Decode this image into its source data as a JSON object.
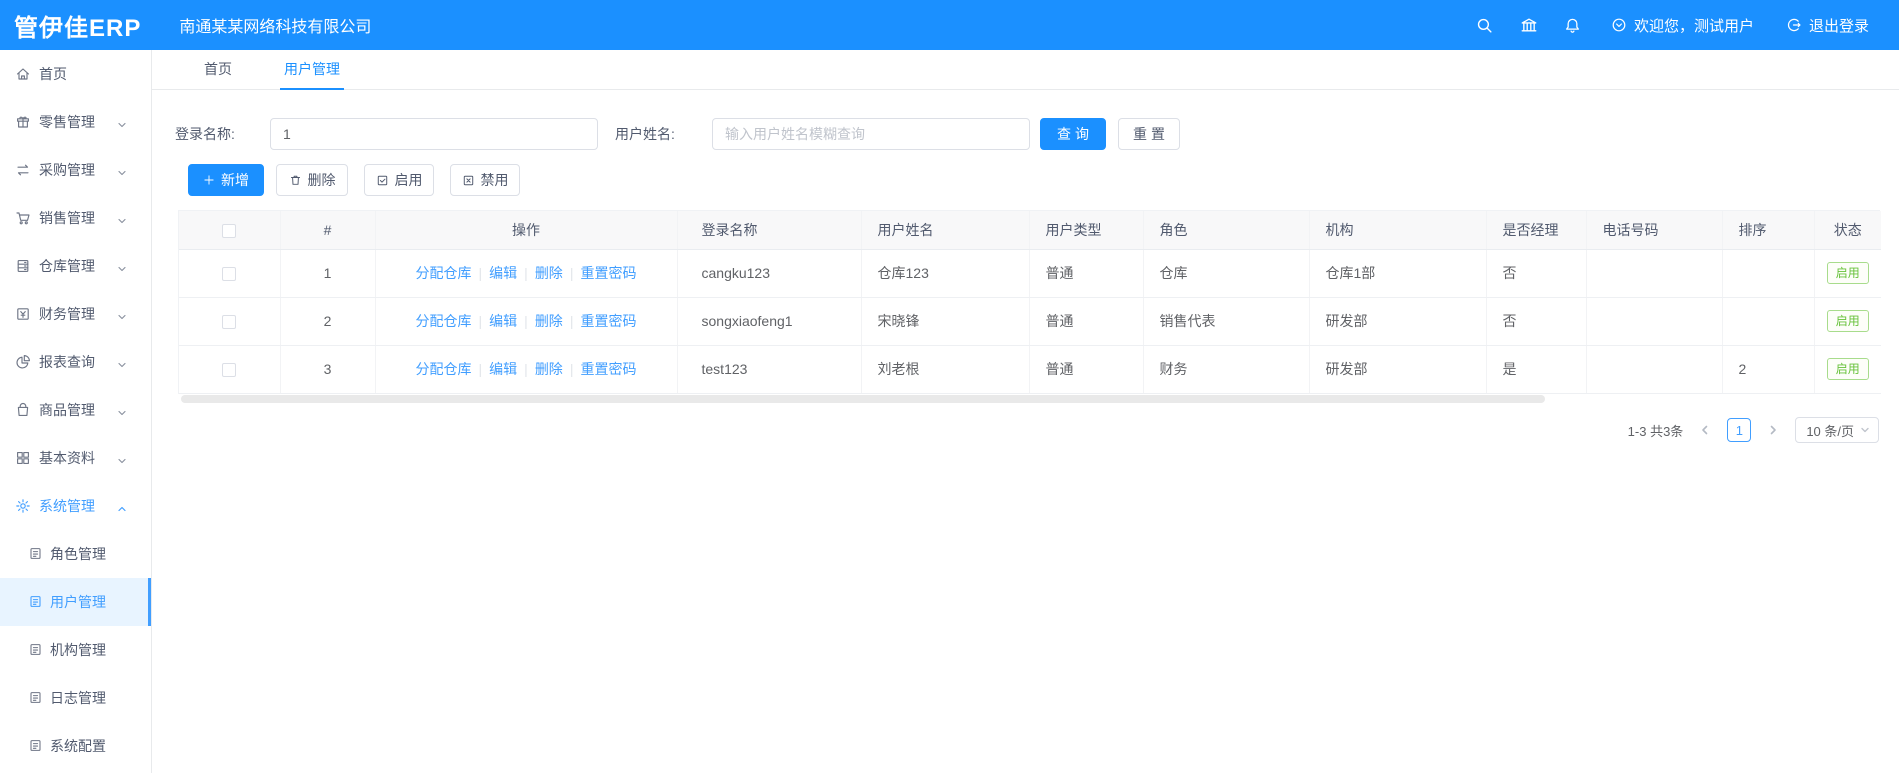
{
  "header": {
    "logo": "管伊佳ERP",
    "company": "南通某某网络科技有限公司",
    "welcome": "欢迎您，测试用户",
    "logout": "退出登录",
    "icons": [
      "search-icon",
      "bank-icon",
      "bell-icon"
    ]
  },
  "sidebar": {
    "items": [
      {
        "label": "首页",
        "icon": "home-icon",
        "type": "parent"
      },
      {
        "label": "零售管理",
        "icon": "retail-icon",
        "type": "parent",
        "chevron": "down"
      },
      {
        "label": "采购管理",
        "icon": "purchase-icon",
        "type": "parent",
        "chevron": "down"
      },
      {
        "label": "销售管理",
        "icon": "sales-cart-icon",
        "type": "parent",
        "chevron": "down"
      },
      {
        "label": "仓库管理",
        "icon": "warehouse-icon",
        "type": "parent",
        "chevron": "down"
      },
      {
        "label": "财务管理",
        "icon": "finance-icon",
        "type": "parent",
        "chevron": "down"
      },
      {
        "label": "报表查询",
        "icon": "report-pie-icon",
        "type": "parent",
        "chevron": "down"
      },
      {
        "label": "商品管理",
        "icon": "goods-bag-icon",
        "type": "parent",
        "chevron": "down"
      },
      {
        "label": "基本资料",
        "icon": "basic-data-icon",
        "type": "parent",
        "chevron": "down"
      },
      {
        "label": "系统管理",
        "icon": "gear-icon",
        "type": "parent",
        "chevron": "up",
        "active": true
      },
      {
        "label": "角色管理",
        "icon": "doc-icon",
        "type": "sub"
      },
      {
        "label": "用户管理",
        "icon": "doc-icon",
        "type": "sub",
        "active": true
      },
      {
        "label": "机构管理",
        "icon": "doc-icon",
        "type": "sub"
      },
      {
        "label": "日志管理",
        "icon": "doc-icon",
        "type": "sub"
      },
      {
        "label": "系统配置",
        "icon": "doc-icon",
        "type": "sub"
      }
    ]
  },
  "tabs": [
    {
      "label": "首页",
      "active": false
    },
    {
      "label": "用户管理",
      "active": true
    }
  ],
  "search": {
    "login_label": "登录名称:",
    "login_value": "1",
    "name_label": "用户姓名:",
    "name_placeholder": "输入用户姓名模糊查询",
    "query_button": "查询",
    "reset_button": "重置"
  },
  "toolbar": {
    "add": "新增",
    "delete": "删除",
    "enable": "启用",
    "disable": "禁用"
  },
  "table": {
    "columns": [
      "#",
      "操作",
      "登录名称",
      "用户姓名",
      "用户类型",
      "角色",
      "机构",
      "是否经理",
      "电话号码",
      "排序",
      "状态"
    ],
    "op_links": [
      "分配仓库",
      "编辑",
      "删除",
      "重置密码"
    ],
    "rows": [
      {
        "index": "1",
        "login": "cangku123",
        "name": "仓库123",
        "type": "普通",
        "role": "仓库",
        "org": "仓库1部",
        "manager": "否",
        "phone": "",
        "sort": "",
        "status": "启用"
      },
      {
        "index": "2",
        "login": "songxiaofeng1",
        "name": "宋晓锋",
        "type": "普通",
        "role": "销售代表",
        "org": "研发部",
        "manager": "否",
        "phone": "",
        "sort": "",
        "status": "启用"
      },
      {
        "index": "3",
        "login": "test123",
        "name": "刘老根",
        "type": "普通",
        "role": "财务",
        "org": "研发部",
        "manager": "是",
        "phone": "",
        "sort": "2",
        "status": "启用"
      }
    ]
  },
  "pagination": {
    "total": "1-3 共3条",
    "page": "1",
    "page_size": "10 条/页"
  },
  "colors": {
    "header_bg": "#1b90ff",
    "primary": "#1b90ff",
    "link": "#419eff",
    "success_text": "#67c23a",
    "success_border": "#a8dc8c",
    "active_item_bg": "#e8f4ff"
  }
}
